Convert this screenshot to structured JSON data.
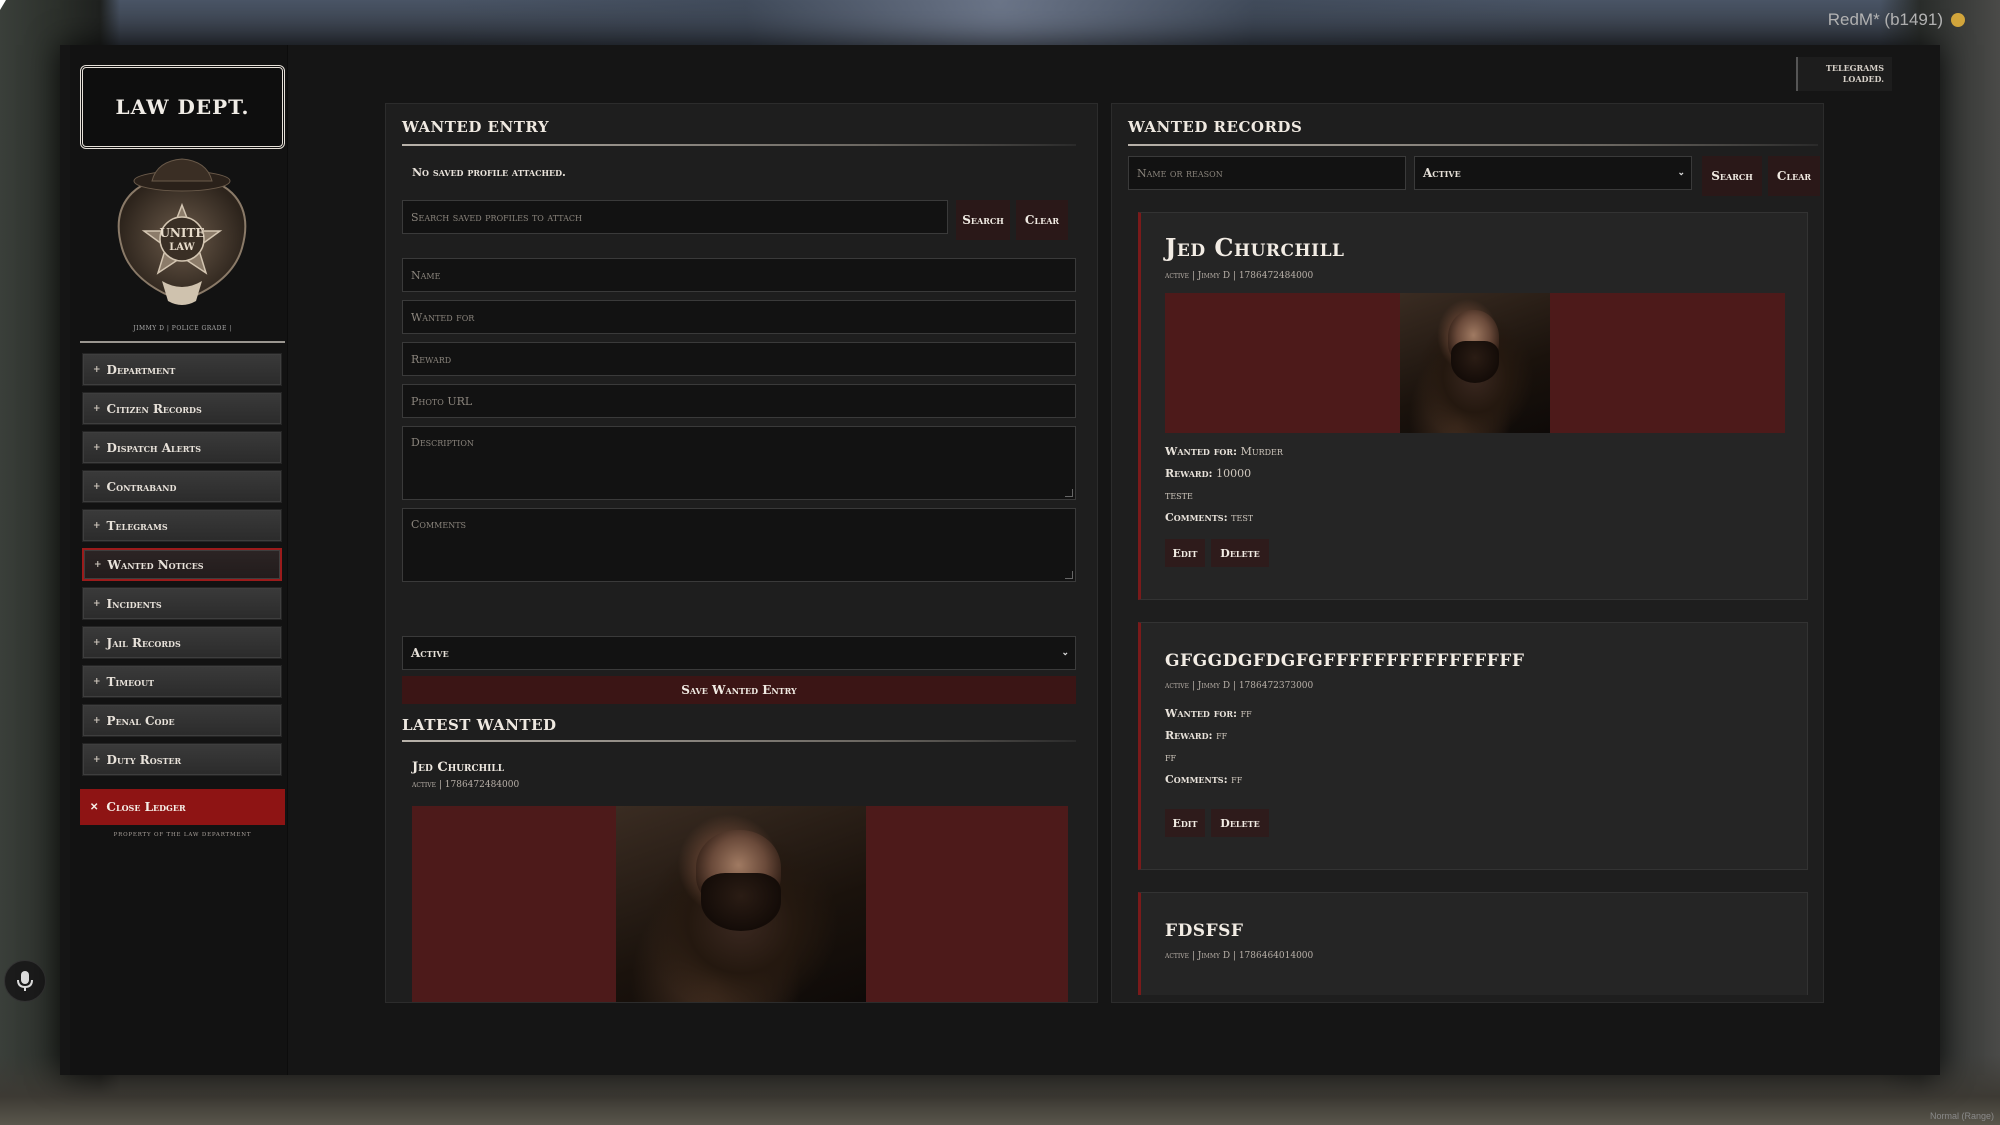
{
  "app": {
    "client_label": "RedM* (b1491)",
    "toast": [
      "TELEGRAMS",
      "LOADED."
    ],
    "corner_note": "Normal (Range)"
  },
  "sidebar": {
    "logo_title": "LAW DEPT.",
    "badge_text": [
      "UNITE",
      "LAW"
    ],
    "officer_line": "JIMMY D | POLICE GRADE |",
    "items": [
      {
        "label": "Department"
      },
      {
        "label": "Citizen Records"
      },
      {
        "label": "Dispatch Alerts"
      },
      {
        "label": "Contraband"
      },
      {
        "label": "Telegrams"
      },
      {
        "label": "Wanted Notices"
      },
      {
        "label": "Incidents"
      },
      {
        "label": "Jail Records"
      },
      {
        "label": "Timeout"
      },
      {
        "label": "Penal Code"
      },
      {
        "label": "Duty Roster"
      }
    ],
    "active_item": "Wanted Notices",
    "close_label": "Close Ledger",
    "property_note": "PROPERTY OF THE LAW DEPARTMENT"
  },
  "entry": {
    "title": "WANTED ENTRY",
    "profile_note": "No saved profile attached.",
    "search_placeholder": "Search saved profiles to attach",
    "search_button": "Search",
    "clear_button": "Clear",
    "fields": {
      "name": "Name",
      "wanted_for": "Wanted for",
      "reward": "Reward",
      "photo_url": "Photo URL",
      "description": "Description",
      "comments": "Comments"
    },
    "status_value": "Active",
    "save_button": "Save Wanted Entry",
    "latest_title": "LATEST WANTED",
    "latest": {
      "name": "Jed Churchill",
      "meta": "active | 1786472484000"
    }
  },
  "records": {
    "title": "WANTED RECORDS",
    "search_placeholder": "Name or reason",
    "status_filter": "Active",
    "search_button": "Search",
    "clear_button": "Clear",
    "edit_label": "Edit",
    "delete_label": "Delete",
    "wanted_for_label": "Wanted for:",
    "reward_label": "Reward:",
    "comments_label": "Comments:",
    "items": [
      {
        "name": "Jed Churchill",
        "meta": "active | Jimmy D | 1786472484000",
        "wanted_for": "Murder",
        "reward": "10000",
        "description": "teste",
        "comments": "test"
      },
      {
        "name": "gfggdgfdgfgffffffffffffffff",
        "meta": "active | Jimmy D | 1786472373000",
        "wanted_for": "ff",
        "reward": "ff",
        "description": "ff",
        "comments": "ff"
      },
      {
        "name": "fdsfsf",
        "meta": "active | Jimmy D | 1786464014000"
      }
    ]
  },
  "colors": {
    "accent_red": "#8e1414",
    "panel_bg": "#1e1e1e",
    "photo_bg": "#4d1a1a"
  }
}
